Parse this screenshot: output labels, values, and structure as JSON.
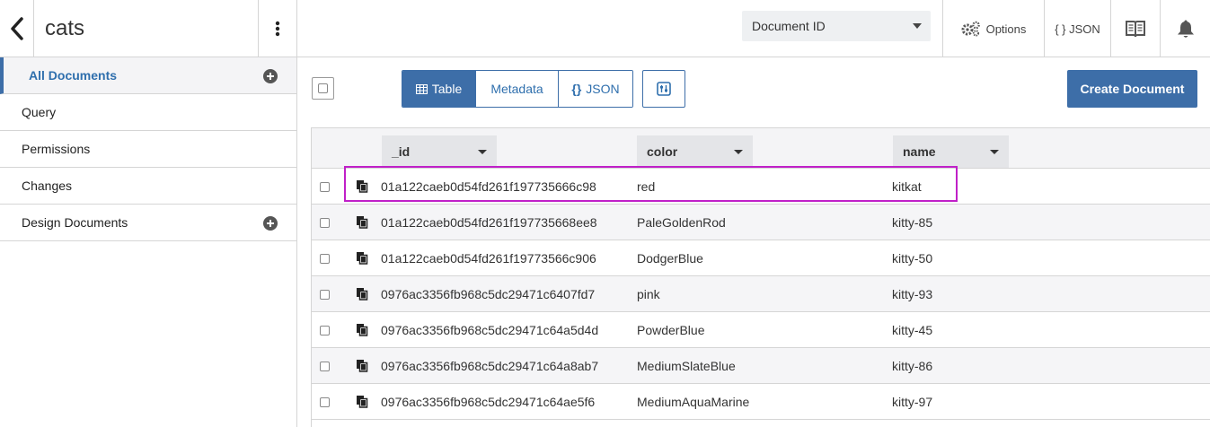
{
  "header": {
    "db_name": "cats",
    "doc_select": {
      "selected": "Document ID"
    },
    "options_label": "Options",
    "json_label": "{ } JSON"
  },
  "sidebar": {
    "items": [
      {
        "label": "All Documents",
        "active": true,
        "has_add": true
      },
      {
        "label": "Query"
      },
      {
        "label": "Permissions"
      },
      {
        "label": "Changes"
      },
      {
        "label": "Design Documents",
        "has_add": true
      }
    ]
  },
  "toolbar": {
    "view_buttons": [
      "Table",
      "Metadata",
      "JSON"
    ],
    "active_view": "Table",
    "create_label": "Create Document"
  },
  "table": {
    "columns": [
      "_id",
      "color",
      "name"
    ],
    "rows": [
      {
        "_id": "01a122caeb0d54fd261f197735666c98",
        "color": "red",
        "name": "kitkat"
      },
      {
        "_id": "01a122caeb0d54fd261f197735668ee8",
        "color": "PaleGoldenRod",
        "name": "kitty-85"
      },
      {
        "_id": "01a122caeb0d54fd261f19773566c906",
        "color": "DodgerBlue",
        "name": "kitty-50"
      },
      {
        "_id": "0976ac3356fb968c5dc29471c6407fd7",
        "color": "pink",
        "name": "kitty-93"
      },
      {
        "_id": "0976ac3356fb968c5dc29471c64a5d4d",
        "color": "PowderBlue",
        "name": "kitty-45"
      },
      {
        "_id": "0976ac3356fb968c5dc29471c64a8ab7",
        "color": "MediumSlateBlue",
        "name": "kitty-86"
      },
      {
        "_id": "0976ac3356fb968c5dc29471c64ae5f6",
        "color": "MediumAquaMarine",
        "name": "kitty-97"
      }
    ]
  },
  "colors": {
    "accent": "#3d6ea8",
    "highlight": "#c020c8"
  }
}
